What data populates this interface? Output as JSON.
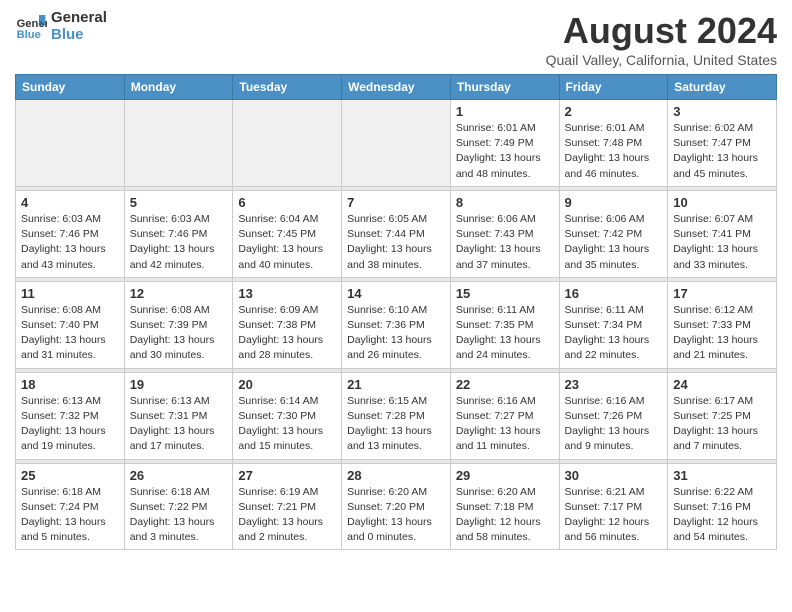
{
  "header": {
    "logo_line1": "General",
    "logo_line2": "Blue",
    "month_title": "August 2024",
    "location": "Quail Valley, California, United States"
  },
  "weekdays": [
    "Sunday",
    "Monday",
    "Tuesday",
    "Wednesday",
    "Thursday",
    "Friday",
    "Saturday"
  ],
  "weeks": [
    [
      {
        "day": "",
        "info": "",
        "empty": true
      },
      {
        "day": "",
        "info": "",
        "empty": true
      },
      {
        "day": "",
        "info": "",
        "empty": true
      },
      {
        "day": "",
        "info": "",
        "empty": true
      },
      {
        "day": "1",
        "info": "Sunrise: 6:01 AM\nSunset: 7:49 PM\nDaylight: 13 hours\nand 48 minutes."
      },
      {
        "day": "2",
        "info": "Sunrise: 6:01 AM\nSunset: 7:48 PM\nDaylight: 13 hours\nand 46 minutes."
      },
      {
        "day": "3",
        "info": "Sunrise: 6:02 AM\nSunset: 7:47 PM\nDaylight: 13 hours\nand 45 minutes."
      }
    ],
    [
      {
        "day": "4",
        "info": "Sunrise: 6:03 AM\nSunset: 7:46 PM\nDaylight: 13 hours\nand 43 minutes."
      },
      {
        "day": "5",
        "info": "Sunrise: 6:03 AM\nSunset: 7:46 PM\nDaylight: 13 hours\nand 42 minutes."
      },
      {
        "day": "6",
        "info": "Sunrise: 6:04 AM\nSunset: 7:45 PM\nDaylight: 13 hours\nand 40 minutes."
      },
      {
        "day": "7",
        "info": "Sunrise: 6:05 AM\nSunset: 7:44 PM\nDaylight: 13 hours\nand 38 minutes."
      },
      {
        "day": "8",
        "info": "Sunrise: 6:06 AM\nSunset: 7:43 PM\nDaylight: 13 hours\nand 37 minutes."
      },
      {
        "day": "9",
        "info": "Sunrise: 6:06 AM\nSunset: 7:42 PM\nDaylight: 13 hours\nand 35 minutes."
      },
      {
        "day": "10",
        "info": "Sunrise: 6:07 AM\nSunset: 7:41 PM\nDaylight: 13 hours\nand 33 minutes."
      }
    ],
    [
      {
        "day": "11",
        "info": "Sunrise: 6:08 AM\nSunset: 7:40 PM\nDaylight: 13 hours\nand 31 minutes."
      },
      {
        "day": "12",
        "info": "Sunrise: 6:08 AM\nSunset: 7:39 PM\nDaylight: 13 hours\nand 30 minutes."
      },
      {
        "day": "13",
        "info": "Sunrise: 6:09 AM\nSunset: 7:38 PM\nDaylight: 13 hours\nand 28 minutes."
      },
      {
        "day": "14",
        "info": "Sunrise: 6:10 AM\nSunset: 7:36 PM\nDaylight: 13 hours\nand 26 minutes."
      },
      {
        "day": "15",
        "info": "Sunrise: 6:11 AM\nSunset: 7:35 PM\nDaylight: 13 hours\nand 24 minutes."
      },
      {
        "day": "16",
        "info": "Sunrise: 6:11 AM\nSunset: 7:34 PM\nDaylight: 13 hours\nand 22 minutes."
      },
      {
        "day": "17",
        "info": "Sunrise: 6:12 AM\nSunset: 7:33 PM\nDaylight: 13 hours\nand 21 minutes."
      }
    ],
    [
      {
        "day": "18",
        "info": "Sunrise: 6:13 AM\nSunset: 7:32 PM\nDaylight: 13 hours\nand 19 minutes."
      },
      {
        "day": "19",
        "info": "Sunrise: 6:13 AM\nSunset: 7:31 PM\nDaylight: 13 hours\nand 17 minutes."
      },
      {
        "day": "20",
        "info": "Sunrise: 6:14 AM\nSunset: 7:30 PM\nDaylight: 13 hours\nand 15 minutes."
      },
      {
        "day": "21",
        "info": "Sunrise: 6:15 AM\nSunset: 7:28 PM\nDaylight: 13 hours\nand 13 minutes."
      },
      {
        "day": "22",
        "info": "Sunrise: 6:16 AM\nSunset: 7:27 PM\nDaylight: 13 hours\nand 11 minutes."
      },
      {
        "day": "23",
        "info": "Sunrise: 6:16 AM\nSunset: 7:26 PM\nDaylight: 13 hours\nand 9 minutes."
      },
      {
        "day": "24",
        "info": "Sunrise: 6:17 AM\nSunset: 7:25 PM\nDaylight: 13 hours\nand 7 minutes."
      }
    ],
    [
      {
        "day": "25",
        "info": "Sunrise: 6:18 AM\nSunset: 7:24 PM\nDaylight: 13 hours\nand 5 minutes."
      },
      {
        "day": "26",
        "info": "Sunrise: 6:18 AM\nSunset: 7:22 PM\nDaylight: 13 hours\nand 3 minutes."
      },
      {
        "day": "27",
        "info": "Sunrise: 6:19 AM\nSunset: 7:21 PM\nDaylight: 13 hours\nand 2 minutes."
      },
      {
        "day": "28",
        "info": "Sunrise: 6:20 AM\nSunset: 7:20 PM\nDaylight: 13 hours\nand 0 minutes."
      },
      {
        "day": "29",
        "info": "Sunrise: 6:20 AM\nSunset: 7:18 PM\nDaylight: 12 hours\nand 58 minutes."
      },
      {
        "day": "30",
        "info": "Sunrise: 6:21 AM\nSunset: 7:17 PM\nDaylight: 12 hours\nand 56 minutes."
      },
      {
        "day": "31",
        "info": "Sunrise: 6:22 AM\nSunset: 7:16 PM\nDaylight: 12 hours\nand 54 minutes."
      }
    ]
  ]
}
